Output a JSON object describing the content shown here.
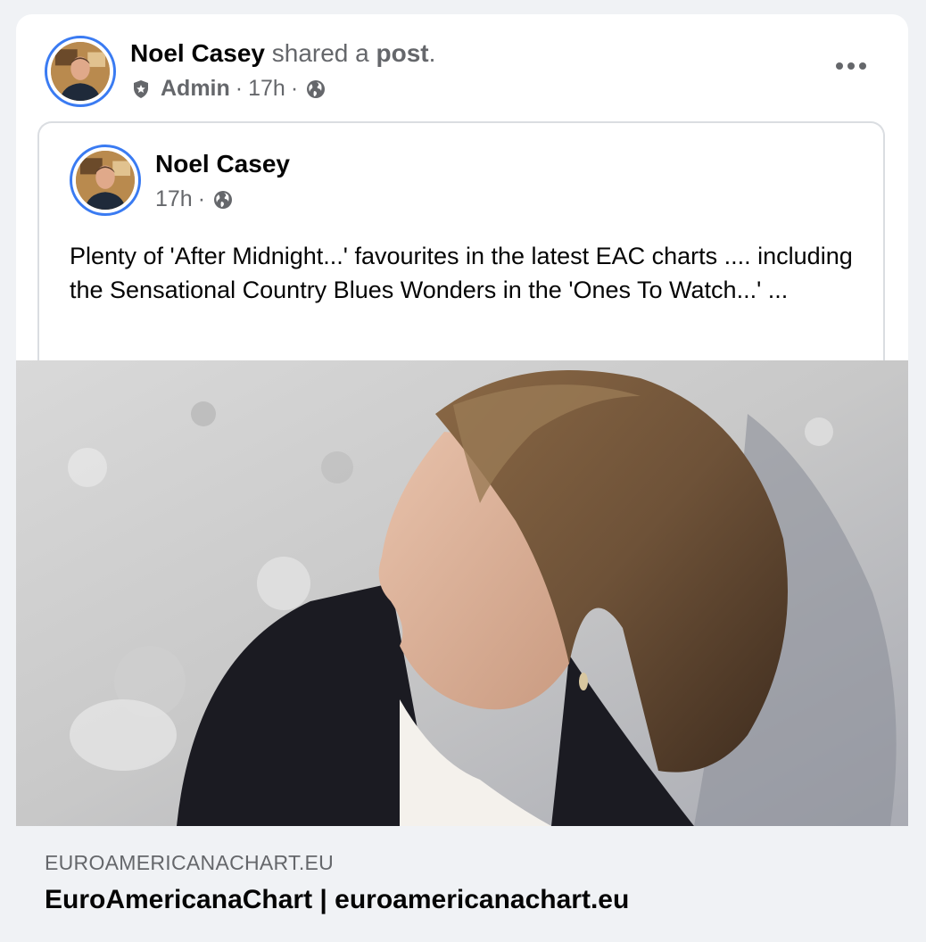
{
  "header": {
    "author_name": "Noel Casey",
    "action_text": "shared a",
    "post_word": "post",
    "period": ".",
    "role": "Admin",
    "time": "17h",
    "separator": "·",
    "audience_icon": "globe-icon",
    "role_icon": "shield-icon",
    "more_icon": "more-horizontal-icon"
  },
  "shared_post": {
    "author_name": "Noel Casey",
    "time": "17h",
    "separator": "·",
    "audience_icon": "globe-icon",
    "text": "Plenty of 'After Midnight...' favourites in the latest EAC charts .... including the Sensational Country Blues Wonders in the 'Ones To Watch...' ..."
  },
  "link_preview": {
    "domain": "EUROAMERICANACHART.EU",
    "title": "EuroAmericanaChart | euroamericanachart.eu"
  },
  "colors": {
    "avatar_ring": "#3a7bf2",
    "primary_text": "#050505",
    "secondary_text": "#65676b",
    "footer_bg": "#f0f2f5"
  }
}
